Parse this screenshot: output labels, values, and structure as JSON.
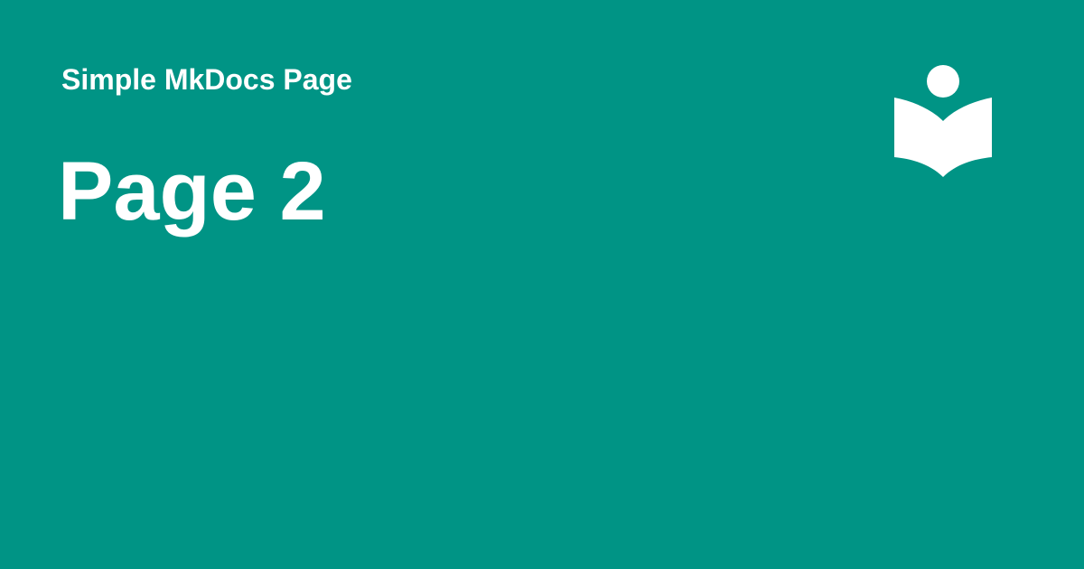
{
  "theme": {
    "background": "#009485",
    "foreground": "#ffffff"
  },
  "site": {
    "name": "Simple MkDocs Page",
    "logo_icon": "book-reader-icon"
  },
  "page": {
    "title": "Page 2"
  }
}
